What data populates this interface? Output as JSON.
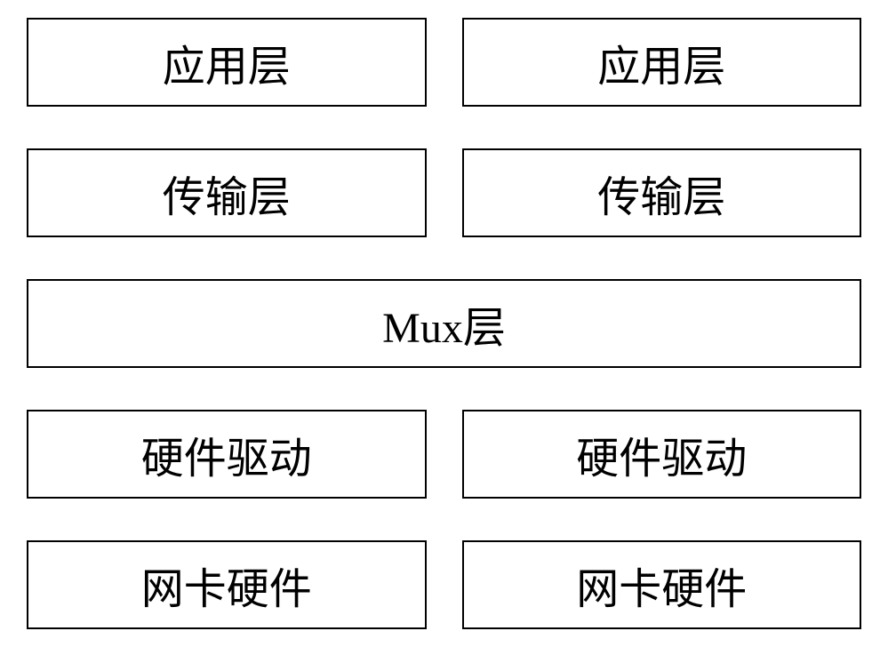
{
  "diagram": {
    "rows": [
      {
        "type": "split",
        "left": "应用层",
        "right": "应用层"
      },
      {
        "type": "split",
        "left": "传输层",
        "right": "传输层"
      },
      {
        "type": "full",
        "label": "Mux层"
      },
      {
        "type": "split",
        "left": "硬件驱动",
        "right": "硬件驱动"
      },
      {
        "type": "split",
        "left": "网卡硬件",
        "right": "网卡硬件"
      }
    ]
  }
}
